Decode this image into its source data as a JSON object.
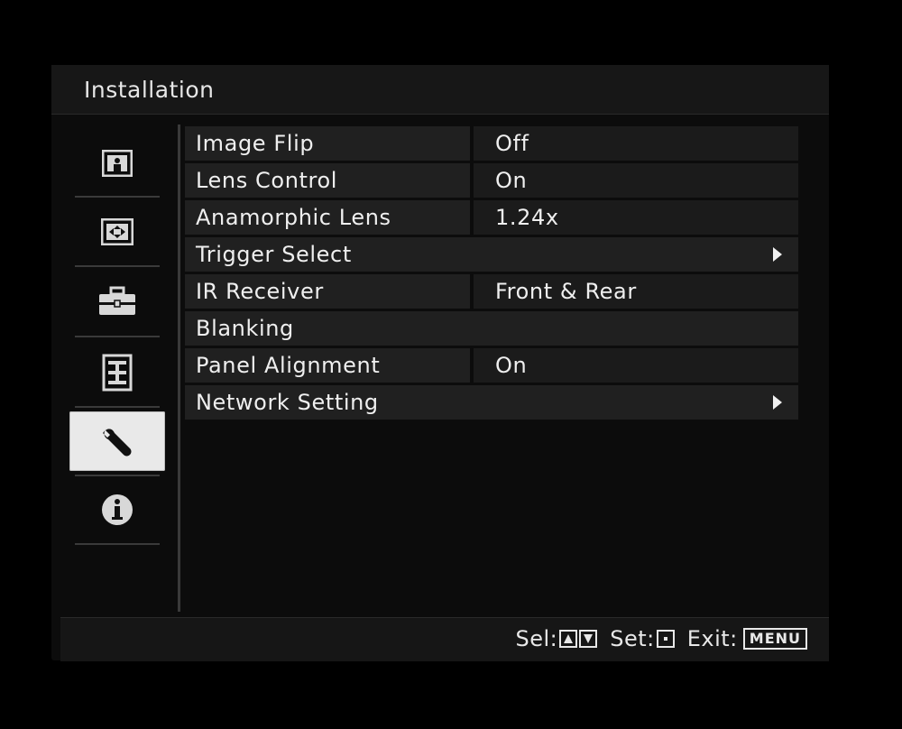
{
  "window": {
    "title": "Installation"
  },
  "sidebar": {
    "items": [
      {
        "icon": "picture-icon",
        "active": false
      },
      {
        "icon": "screen-icon",
        "active": false
      },
      {
        "icon": "toolbox-icon",
        "active": false
      },
      {
        "icon": "list-icon",
        "active": false
      },
      {
        "icon": "wrench-icon",
        "active": true
      },
      {
        "icon": "info-icon",
        "active": false
      }
    ]
  },
  "menu": {
    "rows": [
      {
        "label": "Image Flip",
        "value": "Off"
      },
      {
        "label": "Lens Control",
        "value": "On"
      },
      {
        "label": "Anamorphic Lens",
        "value": "1.24x"
      },
      {
        "label": "Trigger Select",
        "submenu": true
      },
      {
        "label": "IR Receiver",
        "value": "Front & Rear"
      },
      {
        "label": "Blanking"
      },
      {
        "label": "Panel Alignment",
        "value": "On"
      },
      {
        "label": "Network Setting",
        "submenu": true
      }
    ]
  },
  "footer": {
    "sel_label": "Sel:",
    "set_label": "Set:",
    "exit_label": "Exit:",
    "menu_key": "MENU"
  },
  "colors": {
    "background": "#000000",
    "panel": "#0c0c0c",
    "row": "#202020",
    "active_tab": "#e9e9e9",
    "text": "#efefef"
  }
}
